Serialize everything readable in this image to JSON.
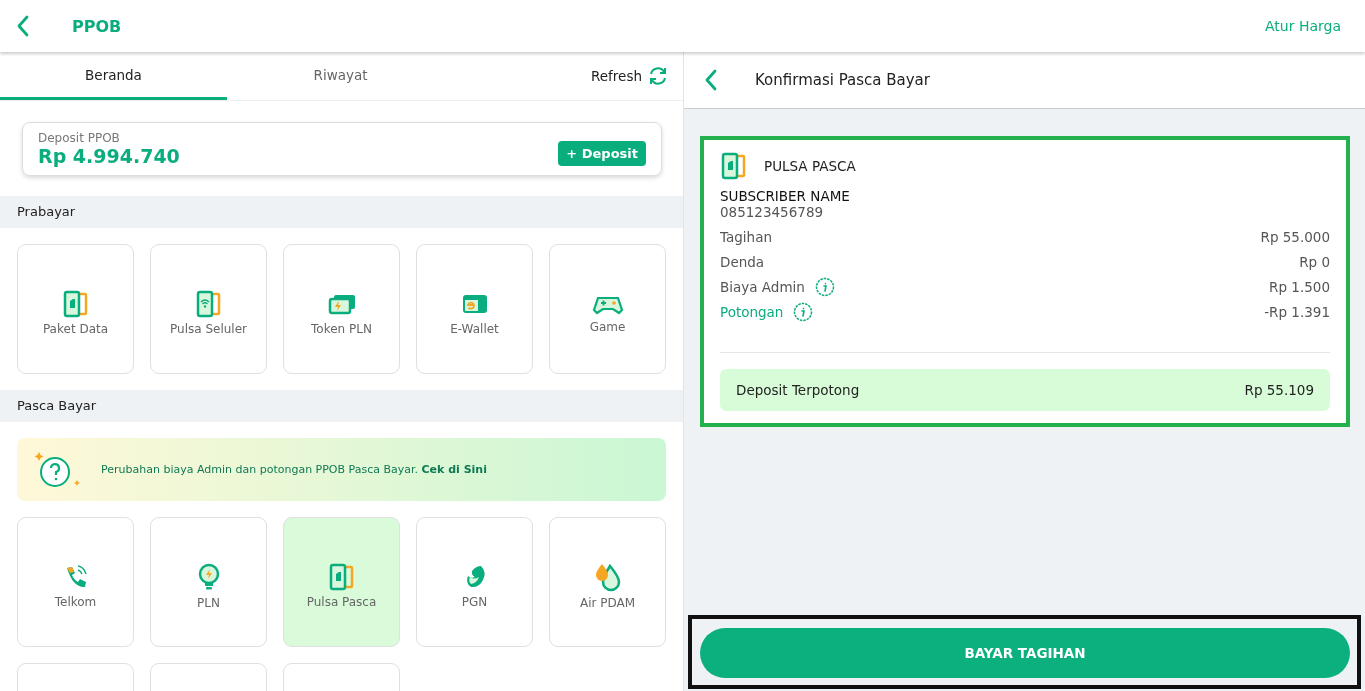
{
  "header": {
    "title": "PPOB",
    "action": "Atur Harga"
  },
  "tabs": [
    {
      "label": "Beranda",
      "selected": true
    },
    {
      "label": "Riwayat",
      "selected": false
    }
  ],
  "refresh": {
    "label": "Refresh"
  },
  "deposit": {
    "label": "Deposit PPOB",
    "amount": "Rp 4.994.740",
    "button": "+ Deposit"
  },
  "prabayar": {
    "title": "Prabayar",
    "items": [
      {
        "kind": "tile",
        "label": "Paket Data",
        "selected": false
      },
      {
        "kind": "tile",
        "label": "Pulsa Seluler",
        "selected": false
      },
      {
        "kind": "tile",
        "label": "Token PLN",
        "selected": false
      },
      {
        "kind": "tile",
        "label": "E-Wallet",
        "selected": false
      },
      {
        "kind": "tile",
        "label": "Game",
        "selected": false
      }
    ]
  },
  "pasca_bayar": {
    "title": "Pasca Bayar",
    "notice": {
      "text": "Perubahan biaya Admin dan potongan PPOB Pasca Bayar.",
      "link": "Cek di Sini"
    },
    "items": [
      {
        "kind": "tile",
        "label": "Telkom",
        "selected": false
      },
      {
        "kind": "tile",
        "label": "PLN",
        "selected": false
      },
      {
        "kind": "tile",
        "label": "Pulsa Pasca",
        "selected": true
      },
      {
        "kind": "tile",
        "label": "PGN",
        "selected": false
      },
      {
        "kind": "tile",
        "label": "Air PDAM",
        "selected": false
      },
      {
        "kind": "partial"
      },
      {
        "kind": "partial"
      },
      {
        "kind": "partial"
      }
    ]
  },
  "confirmation": {
    "title": "Konfirmasi Pasca Bayar",
    "product": "PULSA PASCA",
    "subscriber_name": "SUBSCRIBER NAME",
    "subscriber_number": "085123456789",
    "lines": [
      {
        "kind": "plain",
        "label": "Tagihan",
        "value": "Rp 55.000"
      },
      {
        "kind": "plain",
        "label": "Denda",
        "value": "Rp 0"
      },
      {
        "kind": "info",
        "label": "Biaya Admin",
        "value": "Rp 1.500"
      },
      {
        "kind": "discount",
        "label": "Potongan",
        "value": "-Rp 1.391"
      }
    ],
    "total": {
      "label": "Deposit Terpotong",
      "value": "Rp 55.109"
    },
    "pay_button": "BAYAR TAGIHAN"
  }
}
